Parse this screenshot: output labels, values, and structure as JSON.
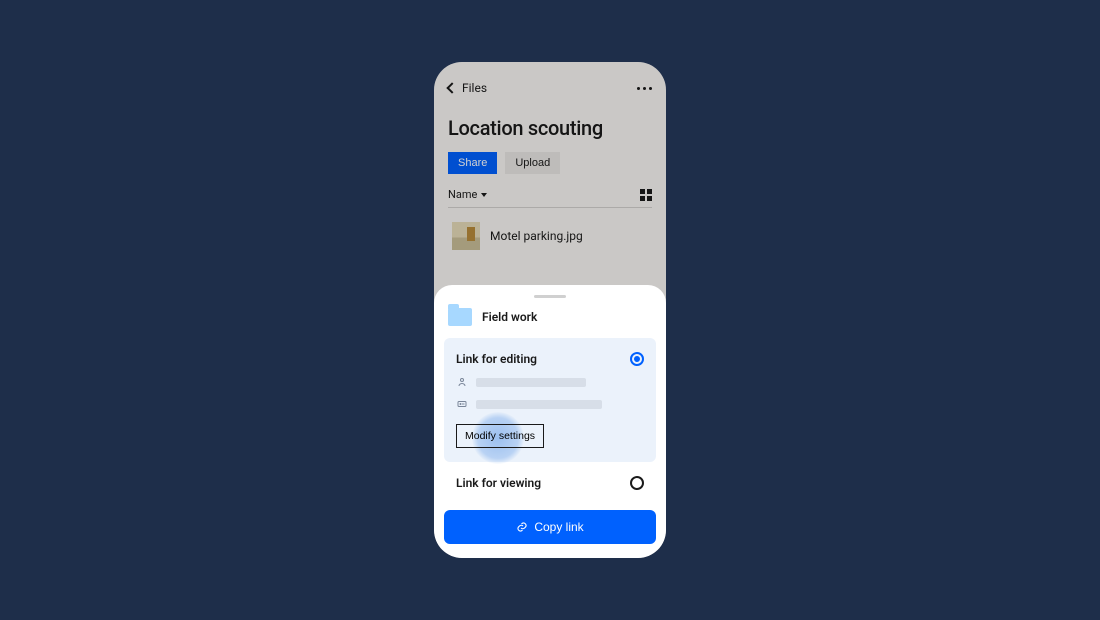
{
  "header": {
    "back_label": "Files",
    "title": "Location scouting"
  },
  "actions": {
    "share_label": "Share",
    "upload_label": "Upload"
  },
  "sort": {
    "label": "Name"
  },
  "files": {
    "first_name": "Motel parking.jpg"
  },
  "sheet": {
    "folder_name": "Field work",
    "option_edit_label": "Link for editing",
    "modify_label": "Modify settings",
    "option_view_label": "Link for viewing",
    "copy_label": "Copy link"
  },
  "colors": {
    "accent": "#0061fe",
    "bg": "#1e2e4a"
  }
}
